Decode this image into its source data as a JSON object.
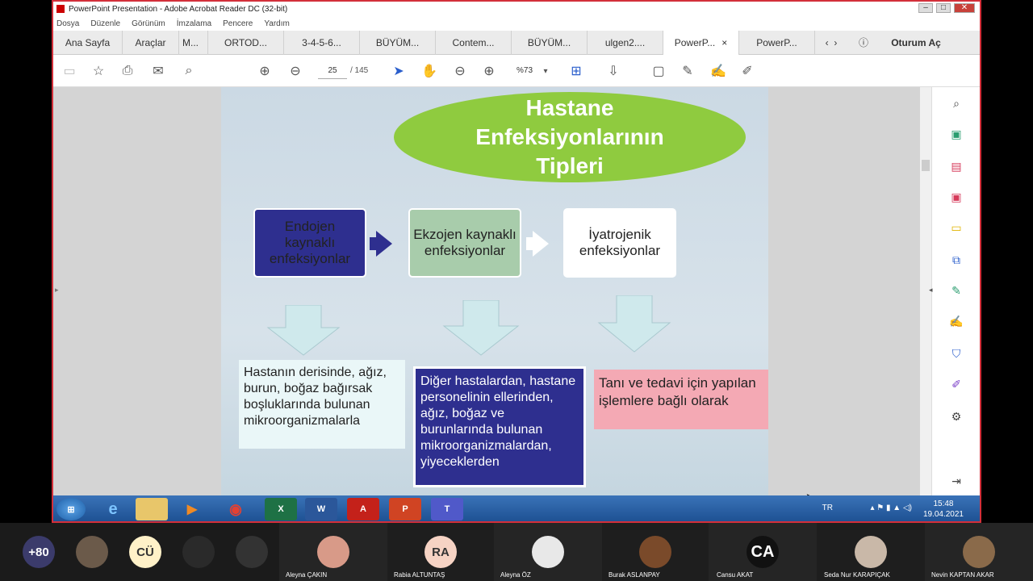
{
  "window": {
    "title": "PowerPoint Presentation - Adobe Acrobat Reader DC (32-bit)"
  },
  "menu": [
    "Dosya",
    "Düzenle",
    "Görünüm",
    "İmzalama",
    "Pencere",
    "Yardım"
  ],
  "tabs": {
    "home": "Ana Sayfa",
    "tools": "Araçlar",
    "t1": "M...",
    "t2": "ORTOD...",
    "t3": "3-4-5-6...",
    "t4": "BÜYÜM...",
    "t5": "Contem...",
    "t6": "BÜYÜM...",
    "t7": "ulgen2....",
    "t8": "PowerP...",
    "t9": "PowerP...",
    "signin": "Oturum Aç",
    "close": "×"
  },
  "toolbar": {
    "page_current": "25",
    "page_total": "/ 145",
    "zoom": "%73"
  },
  "slide": {
    "title_l1": "Hastane",
    "title_l2": "Enfeksiyonlarının",
    "title_l3": "Tipleri",
    "box1": "Endojen kaynaklı enfeksiyonlar",
    "box2": "Ekzojen kaynaklı enfeksiyonlar",
    "box3": "İyatrojenik enfeksiyonlar",
    "text1": "Hastanın derisinde, ağız, burun, boğaz bağırsak boşluklarında bulunan mikroorganizmalarla",
    "text2": "Diğer hastalardan, hastane personelinin ellerinden, ağız, boğaz ve burunlarında bulunan mikroorganizmalardan, yiyeceklerden",
    "text3": "Tanı ve tedavi için yapılan işlemlere bağlı olarak"
  },
  "taskbar": {
    "lang": "TR",
    "time": "15:48",
    "date": "19.04.2021"
  },
  "participants": {
    "count": "+80",
    "p1_initials": "CÜ",
    "p_aleyna_c": "Aleyna ÇAKIN",
    "p_rabia_initials": "RA",
    "p_rabia": "Rabia ALTUNTAŞ",
    "p_aleyna_o": "Aleyna ÖZ",
    "p_burak": "Burak ASLANPAY",
    "p_cansu_initials": "CA",
    "p_cansu": "Cansu AKAT",
    "p_seda": "Seda Nur KARAPIÇAK",
    "p_nevin": "Nevin KAPTAN AKAR"
  },
  "colors": {
    "accent": "#d32f3a",
    "oval": "#8fcb3f",
    "dark_box": "#2e2f8f",
    "green_box": "#a8ccab",
    "pink_box": "#f4a9b4",
    "light_box": "#eaf7f8"
  }
}
